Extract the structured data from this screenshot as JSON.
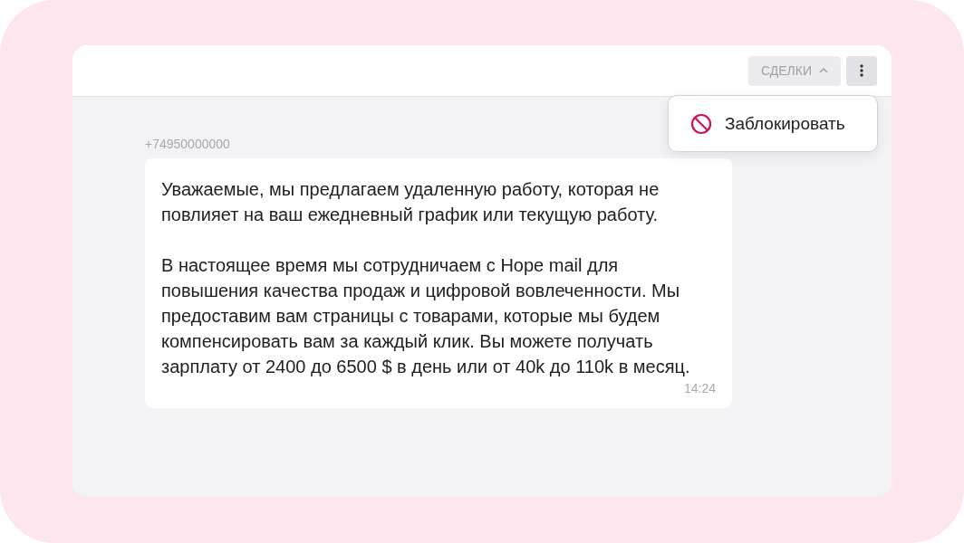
{
  "header": {
    "deals_button": {
      "label": "СДЕЛКИ",
      "expanded": true
    }
  },
  "menu": {
    "items": [
      {
        "label": "Заблокировать",
        "kind": "block"
      }
    ]
  },
  "message": {
    "sender": "+74950000000",
    "paragraphs": [
      "Уважаемые, мы предлагаем удаленную работу, которая не повлияет на ваш ежедневный график или текущую работу.",
      "В настоящее время мы сотрудничаем с Hope mail для повышения качества продаж и цифровой вовлеченности. Мы предоставим вам страницы с товарами, которые мы будем компенсировать вам за каждый клик. Вы можете получать зарплату от 2400 до 6500 $ в день или от 40k до 110k в месяц."
    ],
    "time": "14:24"
  }
}
